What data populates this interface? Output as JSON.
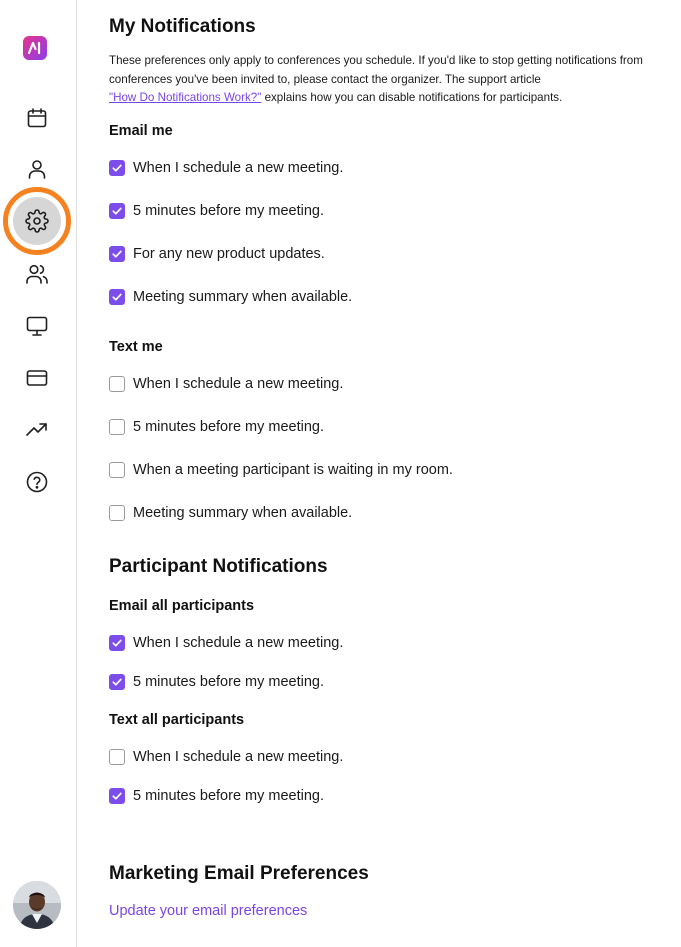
{
  "sidebar": {
    "items": [
      {
        "icon": "calendar-icon"
      },
      {
        "icon": "user-icon"
      },
      {
        "icon": "gear-icon",
        "active": true
      },
      {
        "icon": "users-icon"
      },
      {
        "icon": "monitor-icon"
      },
      {
        "icon": "credit-card-icon"
      },
      {
        "icon": "trending-up-icon"
      },
      {
        "icon": "help-circle-icon"
      }
    ],
    "accent_color": "#f58220"
  },
  "colors": {
    "checkbox_on": "#7c4dea",
    "link": "#7a45e8"
  },
  "my_notifications": {
    "title": "My Notifications",
    "intro_text": "These preferences only apply to conferences you schedule. If you'd like to stop getting notifications from conferences you've been invited to, please contact the organizer. The support article ",
    "intro_link": "\"How Do Notifications Work?\"",
    "intro_suffix": " explains how you can disable notifications for participants.",
    "email_me": {
      "label": "Email me",
      "options": [
        {
          "label": "When I schedule a new meeting.",
          "checked": true
        },
        {
          "label": "5 minutes before my meeting.",
          "checked": true
        },
        {
          "label": "For any new product updates.",
          "checked": true
        },
        {
          "label": "Meeting summary when available.",
          "checked": true
        }
      ]
    },
    "text_me": {
      "label": "Text me",
      "options": [
        {
          "label": "When I schedule a new meeting.",
          "checked": false
        },
        {
          "label": "5 minutes before my meeting.",
          "checked": false
        },
        {
          "label": "When a meeting participant is waiting in my room.",
          "checked": false
        },
        {
          "label": "Meeting summary when available.",
          "checked": false
        }
      ]
    }
  },
  "participant_notifications": {
    "title": "Participant Notifications",
    "email_all": {
      "label": "Email all participants",
      "options": [
        {
          "label": "When I schedule a new meeting.",
          "checked": true
        },
        {
          "label": "5 minutes before my meeting.",
          "checked": true
        }
      ]
    },
    "text_all": {
      "label": "Text all participants",
      "options": [
        {
          "label": "When I schedule a new meeting.",
          "checked": false
        },
        {
          "label": "5 minutes before my meeting.",
          "checked": true
        }
      ]
    }
  },
  "marketing": {
    "title": "Marketing Email Preferences",
    "link": "Update your email preferences"
  }
}
